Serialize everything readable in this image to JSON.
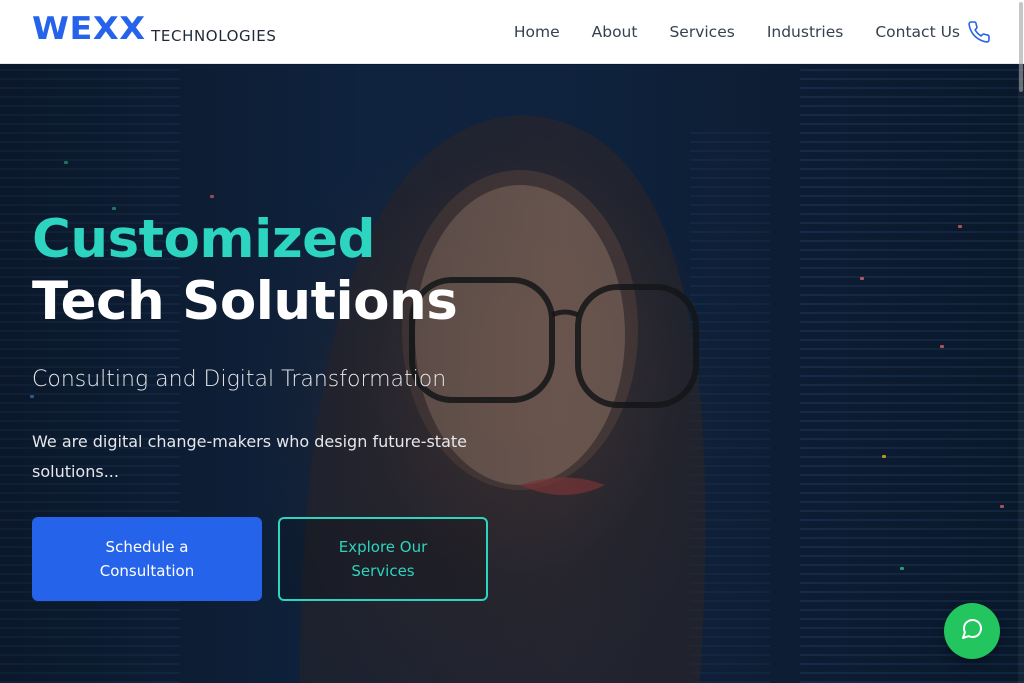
{
  "brand": {
    "name": "WEXX",
    "tagline": "TECHNOLOGIES",
    "color": "#2563eb"
  },
  "nav": {
    "items": [
      {
        "label": "Home"
      },
      {
        "label": "About"
      },
      {
        "label": "Services"
      },
      {
        "label": "Industries"
      },
      {
        "label": "Contact Us"
      }
    ],
    "contact_icon": "phone-icon"
  },
  "hero": {
    "title_line1": "Customized",
    "title_line2": "Tech Solutions",
    "subtitle": "Consulting and Digital Transformation",
    "description": "We are digital change-makers who design future-state solutions...",
    "primary_cta": "Schedule a Consultation",
    "secondary_cta": "Explore Our Services",
    "accent_color": "#2dd4bf"
  },
  "chat": {
    "icon": "chat-bubble-icon",
    "color": "#22c55e"
  }
}
